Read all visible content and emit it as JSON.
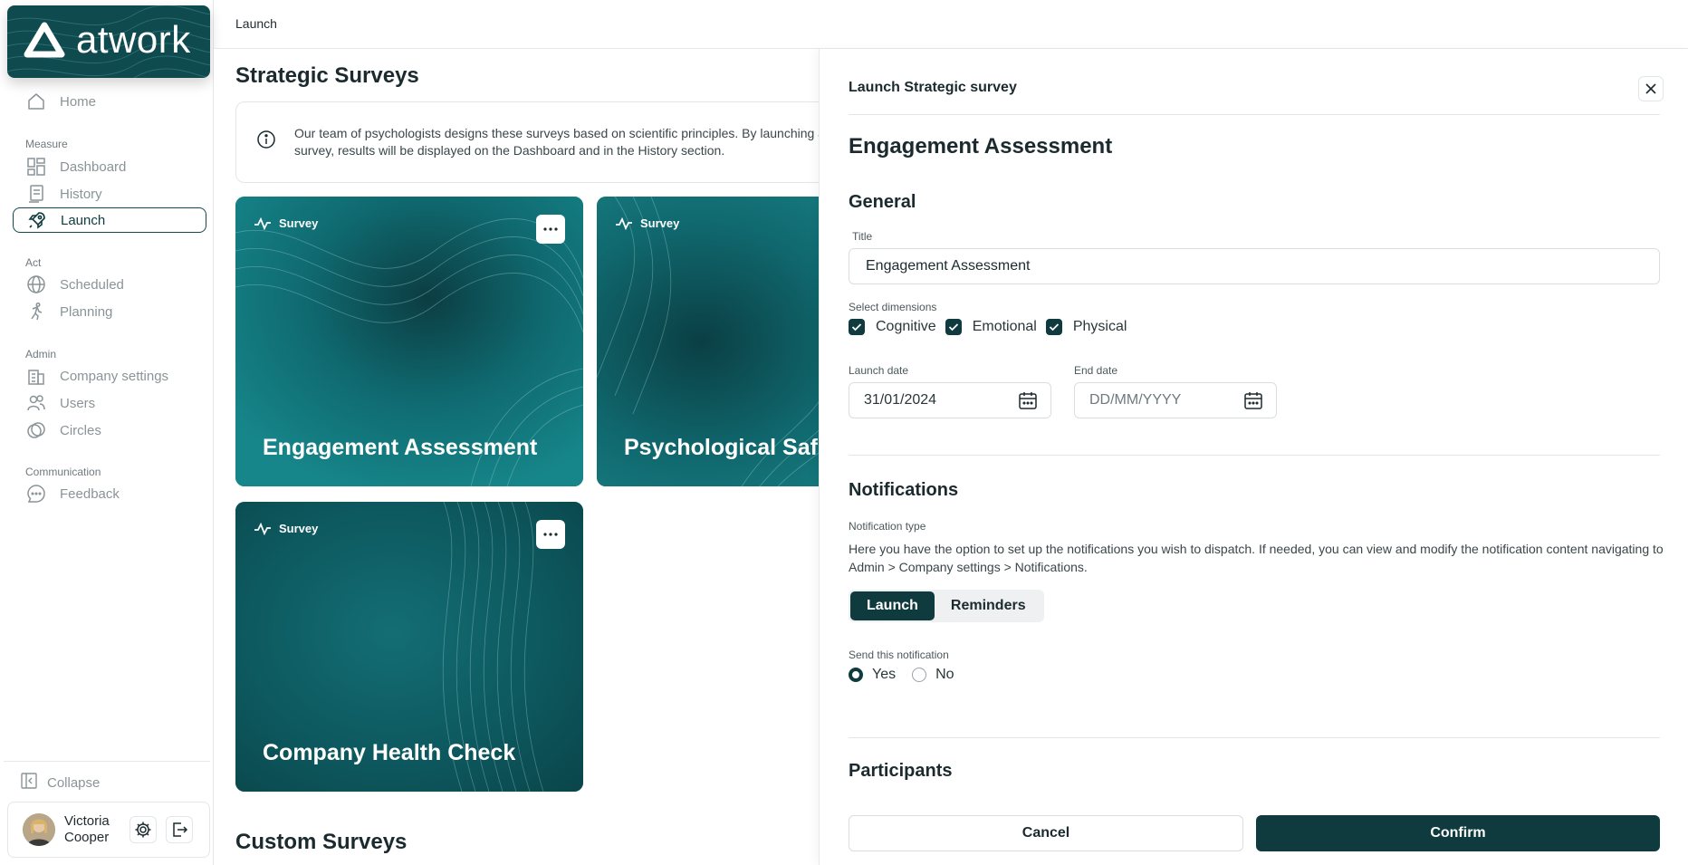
{
  "brand": {
    "name": "atwork",
    "accent": "#0f3a3e"
  },
  "sidebar": {
    "home": "Home",
    "sections": [
      {
        "title": "Measure",
        "items": [
          "Dashboard",
          "History",
          "Launch"
        ]
      },
      {
        "title": "Act",
        "items": [
          "Scheduled",
          "Planning"
        ]
      },
      {
        "title": "Admin",
        "items": [
          "Company settings",
          "Users",
          "Circles"
        ]
      },
      {
        "title": "Communication",
        "items": [
          "Feedback"
        ]
      }
    ],
    "active": "Launch",
    "collapse": "Collapse",
    "user": {
      "first": "Victoria",
      "last": "Cooper"
    }
  },
  "topbar": {
    "breadcrumb": "Launch"
  },
  "main": {
    "title": "Strategic Surveys",
    "info": "Our team of psychologists designs these surveys based on scientific principles. By launching a survey, results will be displayed on the Dashboard and in the History section.",
    "cards": [
      {
        "tag": "Survey",
        "title": "Engagement Assessment"
      },
      {
        "tag": "Survey",
        "title": "Psychological Safety"
      },
      {
        "tag": "Survey",
        "title": "Company Health Check"
      }
    ],
    "custom_title": "Custom Surveys"
  },
  "drawer": {
    "header": "Launch Strategic survey",
    "survey_name": "Engagement Assessment",
    "general": "General",
    "title_label": "Title",
    "title_value": "Engagement Assessment",
    "dimensions_label": "Select dimensions",
    "dimensions": [
      "Cognitive",
      "Emotional",
      "Physical"
    ],
    "launch_date_label": "Launch date",
    "launch_date_value": "31/01/2024",
    "end_date_label": "End date",
    "end_date_placeholder": "DD/MM/YYYY",
    "notifications": "Notifications",
    "notification_type_label": "Notification type",
    "notification_note": "Here you have the option to set up the notifications you wish to dispatch. If needed, you can view and modify the notification content navigating to Admin > Company settings > Notifications.",
    "tabs": [
      "Launch",
      "Reminders"
    ],
    "send_label": "Send this notification",
    "send_options": [
      "Yes",
      "No"
    ],
    "participants": "Participants",
    "cancel": "Cancel",
    "confirm": "Confirm"
  }
}
